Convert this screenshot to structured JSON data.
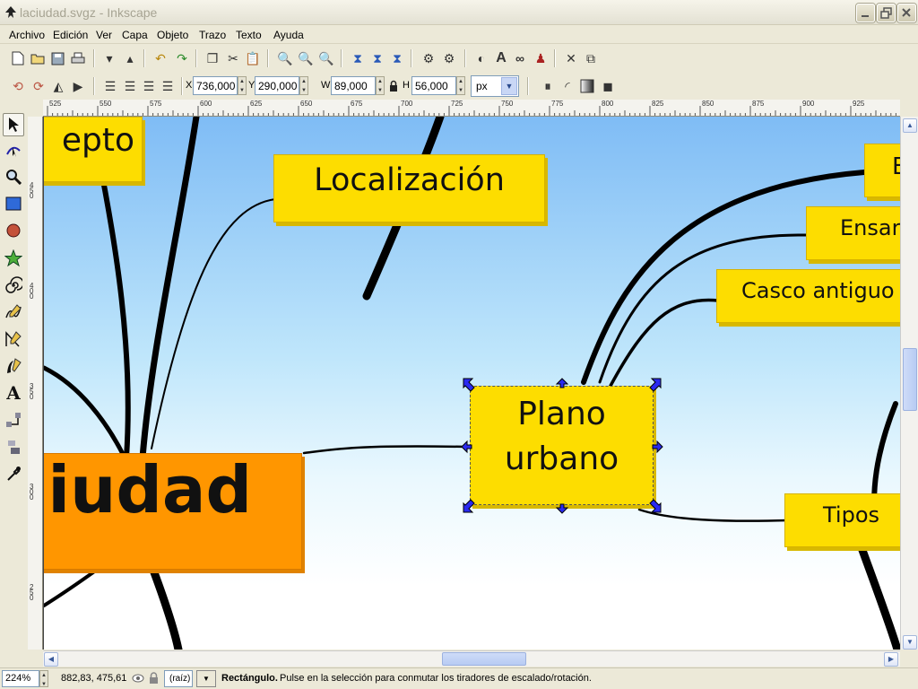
{
  "window": {
    "title": "laciudad.svgz - Inkscape"
  },
  "menu": [
    "Archivo",
    "Edición",
    "Ver",
    "Capa",
    "Objeto",
    "Trazo",
    "Texto",
    "Ayuda"
  ],
  "controls": {
    "x_label": "X",
    "x_value": "736,000",
    "y_label": "Y",
    "y_value": "290,000",
    "w_label": "W",
    "w_value": "89,000",
    "h_label": "H",
    "h_value": "56,000",
    "unit": "px"
  },
  "ruler": {
    "top_ticks": [
      "525",
      "550",
      "575",
      "600",
      "625",
      "650",
      "675",
      "700",
      "725",
      "750",
      "775",
      "800",
      "825",
      "850",
      "875",
      "900",
      "925"
    ],
    "left_ticks": [
      "4 5 0",
      "4 0 0",
      "3 5 0",
      "3 0 0",
      "2 5 0"
    ]
  },
  "canvas": {
    "nodes": {
      "concepto": "epto",
      "localizacion": "Localización",
      "e": "E",
      "ensanche": "Ensar",
      "casco": "Casco antiguo",
      "plano": "Plano urbano",
      "ciudad": "iudad",
      "tipos": "Tipos"
    }
  },
  "status": {
    "zoom": "224%",
    "coords": "882,83, 475,61",
    "layer": "(raíz)",
    "message_bold": "Rectángulo.",
    "message": " Pulse en la selección para conmutar los tiradores de escalado/rotación."
  },
  "colors": {
    "node_yellow": "#fddd00",
    "node_orange": "#ff9600",
    "sky_top": "#7fbcf5",
    "handle_blue": "#2a2af0"
  }
}
